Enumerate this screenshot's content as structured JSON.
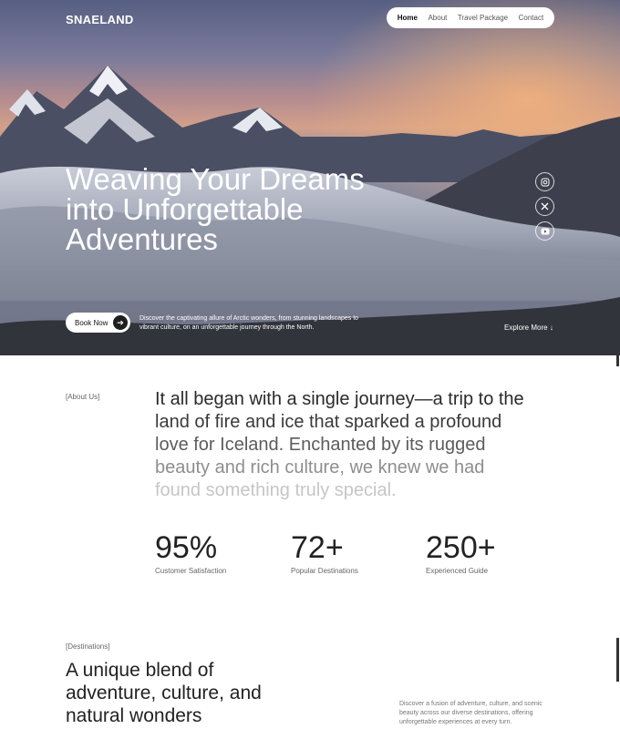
{
  "brand": "SNAELAND",
  "nav": {
    "items": [
      {
        "label": "Home",
        "active": true
      },
      {
        "label": "About",
        "active": false
      },
      {
        "label": "Travel Package",
        "active": false
      },
      {
        "label": "Contact",
        "active": false
      }
    ]
  },
  "hero": {
    "title_lines": [
      "Weaving Your Dreams",
      "into Unforgettable",
      "Adventures"
    ],
    "book_label": "Book Now",
    "description": "Discover the captivating allure of Arctic wonders, from stunning landscapes to vibrant culture, on an unforgettable journey through the North.",
    "explore_label": "Explore More",
    "social_icons": [
      "instagram-icon",
      "x-icon",
      "youtube-icon"
    ]
  },
  "about": {
    "tag": "[About Us]",
    "lines": [
      "It all began with a single journey—a trip to the",
      "land of fire and ice that sparked a profound",
      "love for Iceland. Enchanted by its rugged",
      "beauty and rich culture, we knew we had",
      "found something truly special."
    ],
    "stats": [
      {
        "value": "95%",
        "label": "Customer Satisfaction"
      },
      {
        "value": "72+",
        "label": "Popular Destinations"
      },
      {
        "value": "250+",
        "label": "Experienced Guide"
      }
    ]
  },
  "destinations": {
    "tag": "[Destinations]",
    "title_lines": [
      "A unique blend of",
      "adventure, culture, and",
      "natural wonders"
    ],
    "description": "Discover a fusion of adventure, culture, and scenic beauty across our diverse destinations, offering unforgettable experiences at every turn."
  }
}
